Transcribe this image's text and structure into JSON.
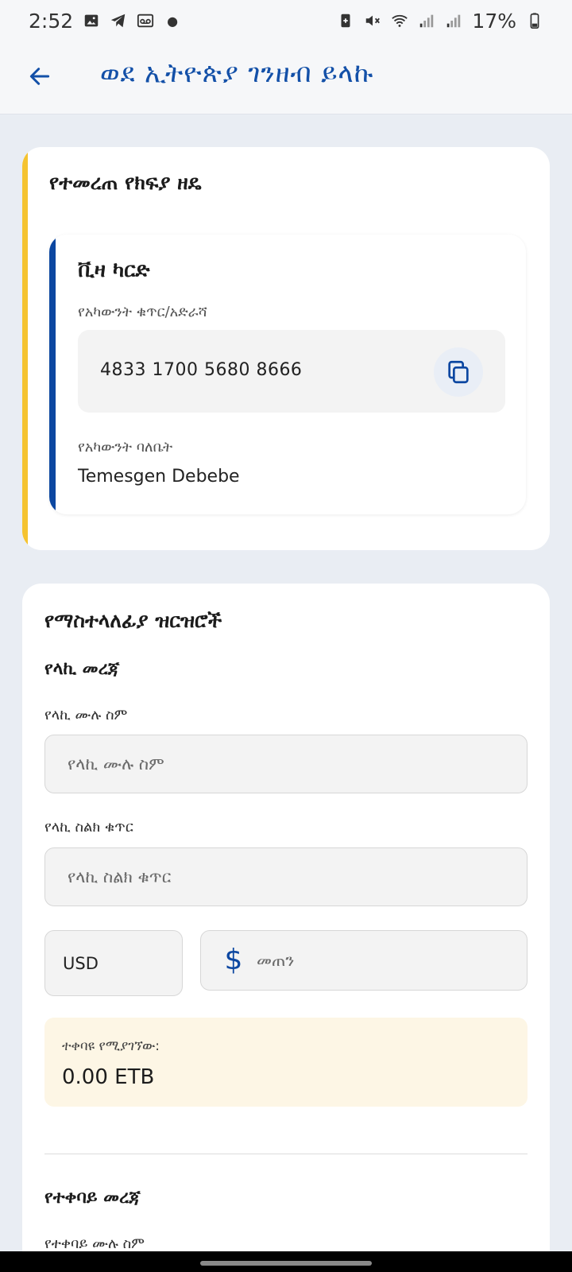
{
  "status_bar": {
    "time": "2:52",
    "battery": "17%",
    "left_icons": [
      "image-icon",
      "telegram-icon",
      "voicemail-icon"
    ],
    "right_icons": [
      "battery-saver-icon",
      "mute-icon",
      "wifi-icon",
      "signal-icon",
      "signal-icon",
      "battery-icon"
    ]
  },
  "app_bar": {
    "title": "ወደ ኢትዮጵያ ገንዘብ ይላኩ",
    "back_icon": "arrow-left-icon"
  },
  "payment_method": {
    "title": "የተመረጠ የክፍያ ዘዴ",
    "method_name": "ቪዛ ካርድ",
    "account_label": "የአካውንት ቁጥር/አድራሻ",
    "account_number": "4833 1700 5680 8666",
    "copy_icon": "copy-icon",
    "owner_label": "የአካውንት ባለቤት",
    "owner_name": "Temesgen Debebe"
  },
  "transfer_details": {
    "title": "የማስተላለፊያ ዝርዝሮች",
    "sender_section": "የላኪ መረጃ",
    "sender_name_label": "የላኪ ሙሉ ስም",
    "sender_name_placeholder": "የላኪ ሙሉ ስም",
    "sender_phone_label": "የላኪ ስልክ ቁጥር",
    "sender_phone_placeholder": "የላኪ ስልክ ቁጥር",
    "currency": "USD",
    "amount_placeholder": "መጠን",
    "dollar_symbol": "$",
    "receive_label": "ተቀባዩ የሚያገኘው:",
    "receive_value": "0.00 ETB",
    "receiver_section": "የተቀባይ መረጃ",
    "receiver_name_label": "የተቀባይ ሙሉ ስም"
  },
  "colors": {
    "primary": "#0c47a1",
    "accent_yellow": "#f5c330",
    "background": "#e9edf3"
  }
}
